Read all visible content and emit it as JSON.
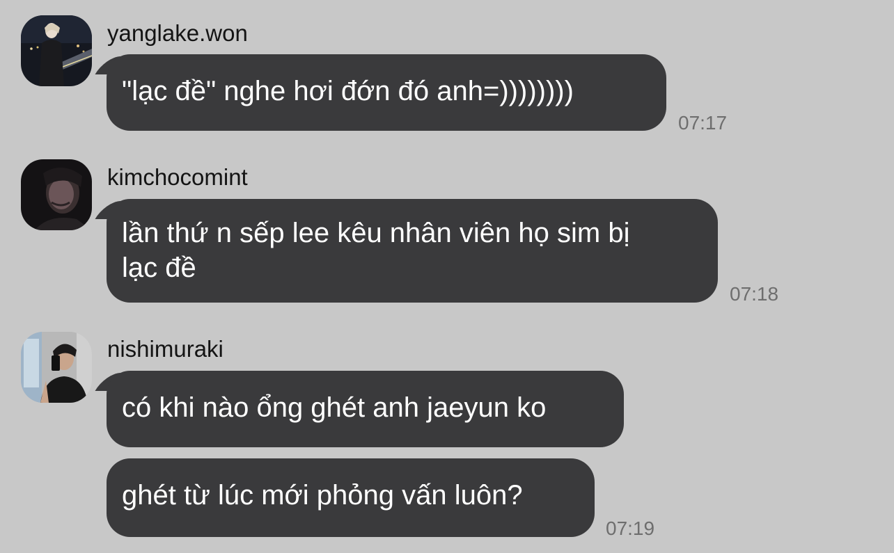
{
  "messages": [
    {
      "sender": "yanglake.won",
      "avatar_icon": "user-avatar-night-city-icon",
      "bubbles": [
        {
          "text": "\"lạc đề\" nghe hơi đớn đó anh=))))))))",
          "time": "07:17"
        }
      ]
    },
    {
      "sender": "kimchocomint",
      "avatar_icon": "user-avatar-dark-portrait-icon",
      "bubbles": [
        {
          "text_lines": [
            "lần thứ n sếp lee kêu nhân viên họ sim bị",
            "lạc đề"
          ],
          "time": "07:18"
        }
      ]
    },
    {
      "sender": "nishimuraki",
      "avatar_icon": "user-avatar-mirror-selfie-icon",
      "bubbles": [
        {
          "text": "có khi nào ổng ghét anh jaeyun ko",
          "time": ""
        },
        {
          "text": "ghét từ lúc mới phỏng vấn luôn?",
          "time": "07:19"
        }
      ]
    }
  ],
  "colors": {
    "background": "#c8c8c8",
    "bubble": "#3a3a3c",
    "bubble_text": "#ffffff",
    "username_text": "#141414",
    "time_text": "#6e6e6e"
  }
}
